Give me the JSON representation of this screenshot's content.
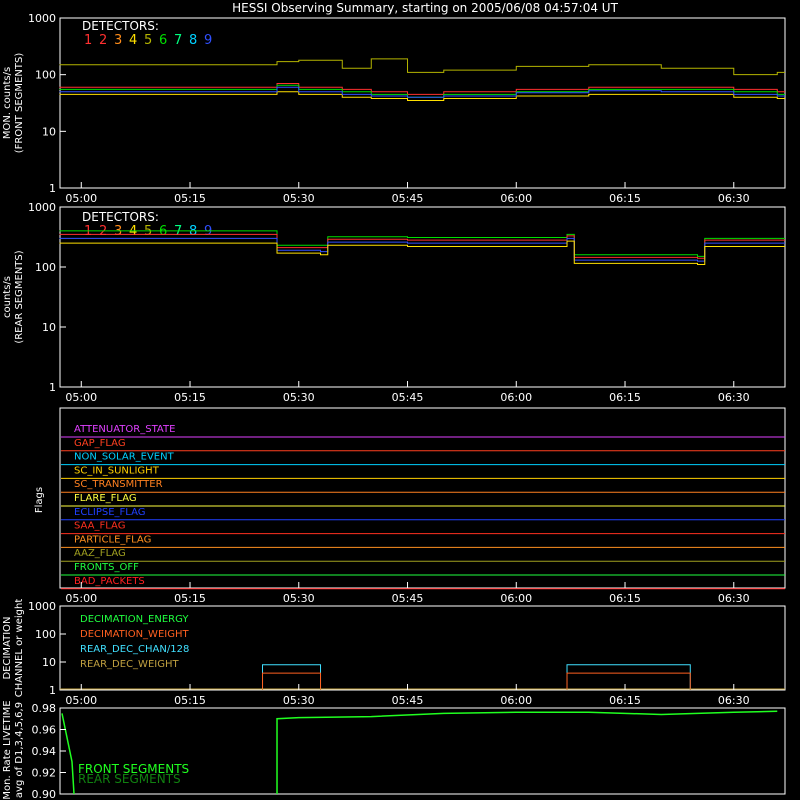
{
  "title": "HESSI Observing Summary, starting on 2005/06/08 04:57:04 UT",
  "time_ticks": [
    "05:00",
    "05:15",
    "05:30",
    "05:45",
    "06:00",
    "06:15",
    "06:30"
  ],
  "colors": {
    "det": [
      "#ff3030",
      "#ff3030",
      "#ff8c1a",
      "#ffe000",
      "#b4b400",
      "#00e000",
      "#00ff80",
      "#00d0ff",
      "#3050ff"
    ],
    "detector_label": "#ffffff",
    "fg": "#ffffff"
  },
  "chart_data": [
    {
      "type": "line",
      "name": "front",
      "ylabel_lines": [
        "MON. counts/s",
        "(FRONT SEGMENTS)"
      ],
      "yscale": "log",
      "ylim": [
        1,
        1000
      ],
      "y_ticks": [
        "1",
        "10",
        "100",
        "1000"
      ],
      "xlim": [
        "04:57:04",
        "06:37:04"
      ],
      "legend_title": "DETECTORS:",
      "legend_digits": [
        "1",
        "2",
        "3",
        "4",
        "5",
        "6",
        "7",
        "8",
        "9"
      ],
      "series": [
        {
          "color_index": 4,
          "x": [
            "04:57",
            "05:27",
            "05:30",
            "05:36",
            "05:40",
            "05:45",
            "05:50",
            "06:00",
            "06:10",
            "06:20",
            "06:30",
            "06:36"
          ],
          "y": [
            150,
            170,
            180,
            130,
            190,
            110,
            120,
            140,
            150,
            130,
            100,
            110
          ]
        },
        {
          "color_index": 0,
          "x": [
            "04:57",
            "05:27",
            "05:30",
            "05:36",
            "05:40",
            "05:45",
            "05:50",
            "06:00",
            "06:10",
            "06:20",
            "06:30",
            "06:36"
          ],
          "y": [
            60,
            70,
            60,
            55,
            50,
            45,
            50,
            55,
            60,
            60,
            55,
            50
          ]
        },
        {
          "color_index": 5,
          "x": [
            "04:57",
            "05:27",
            "05:30",
            "05:36",
            "05:40",
            "05:45",
            "05:50",
            "06:00",
            "06:10",
            "06:20",
            "06:30",
            "06:36"
          ],
          "y": [
            55,
            65,
            55,
            50,
            45,
            40,
            45,
            50,
            55,
            55,
            50,
            45
          ]
        },
        {
          "color_index": 3,
          "x": [
            "04:57",
            "05:27",
            "05:30",
            "05:36",
            "05:40",
            "05:45",
            "05:50",
            "06:00",
            "06:10",
            "06:20",
            "06:30",
            "06:36"
          ],
          "y": [
            45,
            50,
            45,
            40,
            38,
            35,
            38,
            42,
            45,
            45,
            40,
            38
          ]
        },
        {
          "color_index": 8,
          "x": [
            "04:57",
            "05:27",
            "05:30",
            "05:36",
            "05:40",
            "05:45",
            "05:50",
            "06:00",
            "06:10",
            "06:20",
            "06:30",
            "06:36"
          ],
          "y": [
            50,
            60,
            50,
            45,
            42,
            40,
            42,
            48,
            52,
            50,
            45,
            42
          ]
        }
      ]
    },
    {
      "type": "line",
      "name": "rear",
      "ylabel_lines": [
        "counts/s",
        "(REAR SEGMENTS)"
      ],
      "yscale": "log",
      "ylim": [
        1,
        1000
      ],
      "y_ticks": [
        "1",
        "10",
        "100",
        "1000"
      ],
      "xlim": [
        "04:57:04",
        "06:37:04"
      ],
      "legend_title": "DETECTORS:",
      "legend_digits": [
        "1",
        "2",
        "3",
        "4",
        "5",
        "6",
        "7",
        "8",
        "9"
      ],
      "series": [
        {
          "color_index": 5,
          "x": [
            "04:57",
            "05:27",
            "05:33",
            "05:34",
            "05:45",
            "06:07",
            "06:08",
            "06:25",
            "06:26",
            "06:36"
          ],
          "y": [
            400,
            230,
            230,
            320,
            310,
            350,
            160,
            150,
            300,
            300
          ]
        },
        {
          "color_index": 0,
          "x": [
            "04:57",
            "05:27",
            "05:33",
            "05:34",
            "05:45",
            "06:07",
            "06:08",
            "06:25",
            "06:26",
            "06:36"
          ],
          "y": [
            350,
            210,
            210,
            290,
            280,
            330,
            145,
            140,
            280,
            280
          ]
        },
        {
          "color_index": 8,
          "x": [
            "04:57",
            "05:27",
            "05:33",
            "05:34",
            "05:45",
            "06:07",
            "06:08",
            "06:25",
            "06:26",
            "06:36"
          ],
          "y": [
            300,
            190,
            180,
            260,
            250,
            300,
            130,
            125,
            250,
            250
          ]
        },
        {
          "color_index": 3,
          "x": [
            "04:57",
            "05:27",
            "05:33",
            "05:34",
            "05:45",
            "06:07",
            "06:08",
            "06:25",
            "06:26",
            "06:36"
          ],
          "y": [
            250,
            170,
            160,
            230,
            220,
            270,
            115,
            110,
            220,
            220
          ]
        }
      ]
    },
    {
      "type": "flags",
      "name": "flags",
      "ylabel": "Flags",
      "flags": [
        {
          "label": "ATTENUATOR_STATE",
          "color": "#e040ff"
        },
        {
          "label": "GAP_FLAG",
          "color": "#ff4020"
        },
        {
          "label": "NON_SOLAR_EVENT",
          "color": "#00d0ff"
        },
        {
          "label": "SC_IN_SUNLIGHT",
          "color": "#ffd000"
        },
        {
          "label": "SC_TRANSMITTER",
          "color": "#ff8020"
        },
        {
          "label": "FLARE_FLAG",
          "color": "#ffff40"
        },
        {
          "label": "ECLIPSE_FLAG",
          "color": "#2040ff"
        },
        {
          "label": "SAA_FLAG",
          "color": "#ff3020"
        },
        {
          "label": "PARTICLE_FLAG",
          "color": "#ff9020"
        },
        {
          "label": "AAZ_FLAG",
          "color": "#a0a020"
        },
        {
          "label": "FRONTS_OFF",
          "color": "#20ff40"
        },
        {
          "label": "BAD_PACKETS",
          "color": "#ff2020"
        }
      ]
    },
    {
      "type": "line",
      "name": "decimation",
      "ylabel_lines": [
        "DECIMATION",
        "CHANNEL or weight"
      ],
      "yscale": "log",
      "ylim": [
        1,
        1000
      ],
      "y_ticks": [
        "1",
        "10",
        "100",
        "1000"
      ],
      "legend": [
        {
          "label": "DECIMATION_ENERGY",
          "color": "#20ff40"
        },
        {
          "label": "DECIMATION_WEIGHT",
          "color": "#ff6020"
        },
        {
          "label": "REAR_DEC_CHAN/128",
          "color": "#40e0ff"
        },
        {
          "label": "REAR_DEC_WEIGHT",
          "color": "#c0a040"
        }
      ]
    },
    {
      "type": "line",
      "name": "livetime",
      "ylabel_lines": [
        "Mon. Rate LIVETIME",
        "avg of D1,3,4,5,6,9"
      ],
      "ylim": [
        0.9,
        0.98
      ],
      "y_ticks": [
        "0.90",
        "0.92",
        "0.94",
        "0.96",
        "0.98"
      ],
      "legend": [
        {
          "label": "FRONT SEGMENTS",
          "color": "#20ff20"
        },
        {
          "label": "REAR SEGMENTS",
          "color": "#108010"
        }
      ]
    }
  ]
}
